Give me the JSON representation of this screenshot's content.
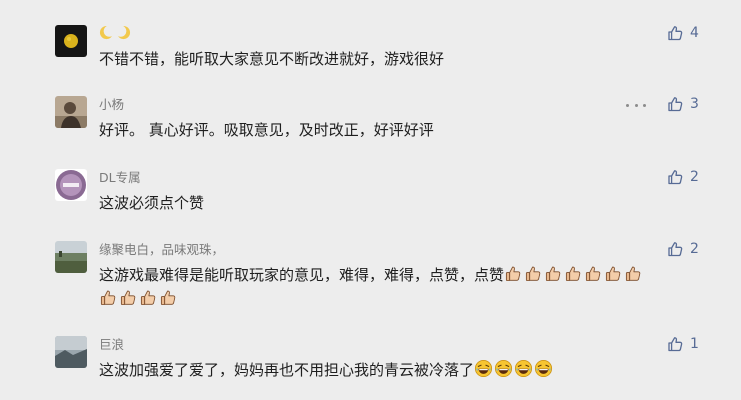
{
  "comments": [
    {
      "name": "",
      "name_emoji": [
        "crescent-moon-icon",
        "crescent-moon-icon"
      ],
      "text_line1": "不错不错，能听取大家意见不断改进就好，游戏很好",
      "likes": "4",
      "avatar": "dark-moon-avatar"
    },
    {
      "name": "小杨",
      "text_line1": "好评。 真心好评。吸取意见，及时改正，好评好评",
      "likes": "3",
      "avatar": "person-avatar",
      "has_more_menu": true
    },
    {
      "name": "DL专属",
      "text_line1": "这波必须点个赞",
      "likes": "2",
      "avatar": "purple-avatar"
    },
    {
      "name": "缘聚电白，品味观珠，",
      "text_line1": "这游戏最难得是能听取玩家的意见，难得，难得，点赞，点赞",
      "line1_emoji": [
        "thumbs-up-icon",
        "thumbs-up-icon",
        "thumbs-up-icon",
        "thumbs-up-icon",
        "thumbs-up-icon",
        "thumbs-up-icon",
        "thumbs-up-icon"
      ],
      "line2_emoji": [
        "thumbs-up-icon",
        "thumbs-up-icon",
        "thumbs-up-icon",
        "thumbs-up-icon"
      ],
      "likes": "2",
      "avatar": "landscape-avatar"
    },
    {
      "name": "巨浪",
      "text_line1": "这波加强爱了爱了，妈妈再也不用担心我的青云被冷落了",
      "line1_emoji": [
        "laughing-face-icon",
        "laughing-face-icon",
        "laughing-face-icon",
        "laughing-face-icon"
      ],
      "likes": "1",
      "avatar": "sky-avatar"
    }
  ],
  "colors": {
    "background": "#ededed",
    "link_blue": "#576b95",
    "name_gray": "#7a7a7a",
    "text": "#1f1f1f"
  }
}
